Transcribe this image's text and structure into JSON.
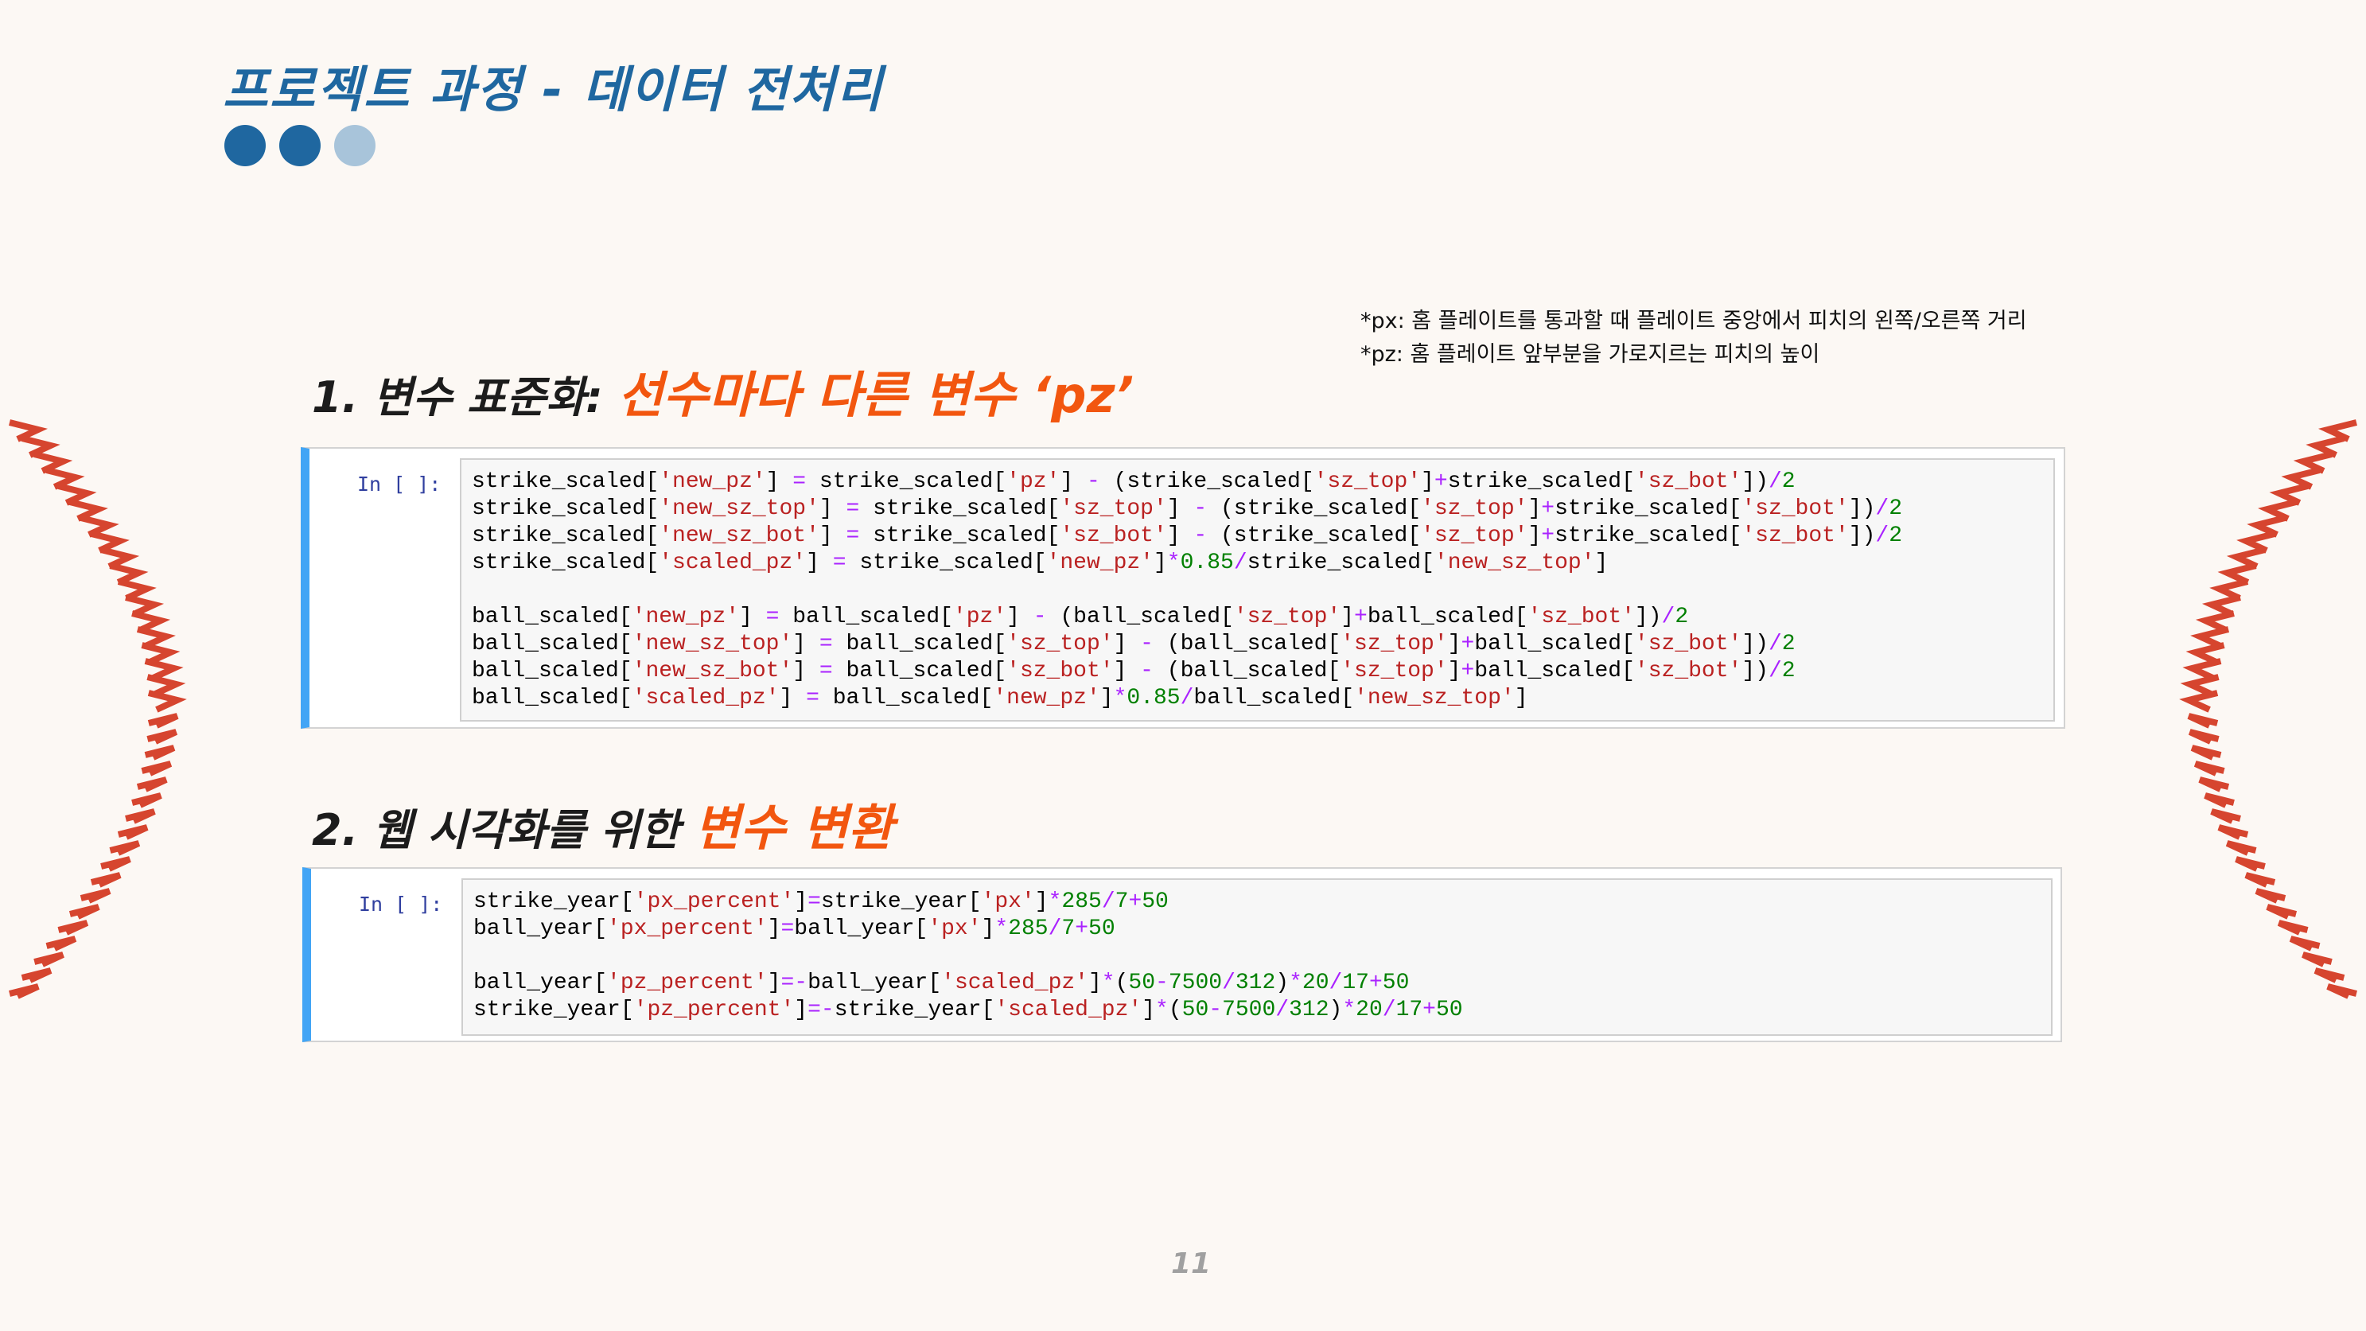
{
  "header": {
    "title": "프로젝트 과정 - 데이터 전처리",
    "title_color": "#1f67a0",
    "progress_dots": [
      {
        "state": "filled",
        "color": "#1f67a0"
      },
      {
        "state": "filled",
        "color": "#1f67a0"
      },
      {
        "state": "empty",
        "color": "#a8c4da"
      }
    ]
  },
  "notes": {
    "px": "*px: 홈 플레이트를 통과할 때 플레이트 중앙에서 피치의 왼쪽/오른쪽 거리",
    "pz": "*pz: 홈 플레이트 앞부분을 가로지르는 피치의 높이"
  },
  "section1": {
    "heading": "1. 변수 표준화: ",
    "heading_accent": "선수마다 다른 변수 ‘pz’",
    "prompt": "In [ ]:",
    "lines": [
      "strike_scaled['new_pz'] = strike_scaled['pz'] - (strike_scaled['sz_top']+strike_scaled['sz_bot'])/2",
      "strike_scaled['new_sz_top'] = strike_scaled['sz_top'] - (strike_scaled['sz_top']+strike_scaled['sz_bot'])/2",
      "strike_scaled['new_sz_bot'] = strike_scaled['sz_bot'] - (strike_scaled['sz_top']+strike_scaled['sz_bot'])/2",
      "strike_scaled['scaled_pz'] = strike_scaled['new_pz']*0.85/strike_scaled['new_sz_top']",
      "",
      "ball_scaled['new_pz'] = ball_scaled['pz'] - (ball_scaled['sz_top']+ball_scaled['sz_bot'])/2",
      "ball_scaled['new_sz_top'] = ball_scaled['sz_top'] - (ball_scaled['sz_top']+ball_scaled['sz_bot'])/2",
      "ball_scaled['new_sz_bot'] = ball_scaled['sz_bot'] - (ball_scaled['sz_top']+ball_scaled['sz_bot'])/2",
      "ball_scaled['scaled_pz'] = ball_scaled['new_pz']*0.85/ball_scaled['new_sz_top']"
    ]
  },
  "section2": {
    "heading": "2. 웹 시각화를 위한 ",
    "heading_accent": "변수 변환",
    "prompt": "In [ ]:",
    "lines": [
      "strike_year['px_percent']=strike_year['px']*285/7+50",
      "ball_year['px_percent']=ball_year['px']*285/7+50",
      "",
      "ball_year['pz_percent']=-ball_year['scaled_pz']*(50-7500/312)*20/17+50",
      "strike_year['pz_percent']=-strike_year['scaled_pz']*(50-7500/312)*20/17+50"
    ]
  },
  "footer": {
    "page_number": "11"
  },
  "colors": {
    "background": "#fcf8f4",
    "accent": "#f2560f",
    "stitch": "#d6452f",
    "cell_border": "#42a5f5"
  }
}
